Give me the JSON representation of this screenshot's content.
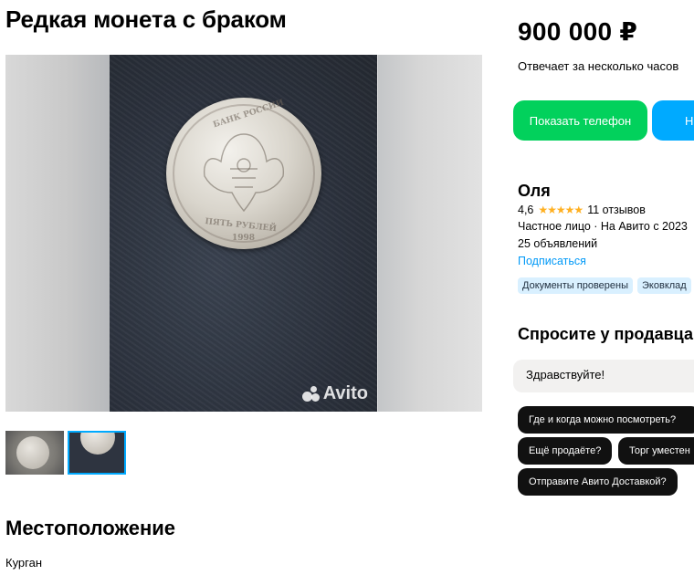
{
  "listing": {
    "title": "Редкая монета с браком",
    "location_heading": "Местоположение",
    "location_value": "Курган"
  },
  "gallery": {
    "watermark": "Avito",
    "thumbnails_count": 2,
    "selected_thumbnail": 2
  },
  "sidebar": {
    "price": "900 000 ₽",
    "reply_time": "Отвечает за несколько часов",
    "show_phone_label": "Показать телефон",
    "message_label": "Н",
    "seller": {
      "name": "Оля",
      "rating": "4,6",
      "stars": "★★★★★",
      "reviews": "11 отзывов",
      "type": "Частное лицо · На Авито с 2023",
      "ads_count": "25 объявлений",
      "subscribe": "Подписаться",
      "badges": [
        "Документы проверены",
        "Эковклад"
      ]
    },
    "ask": {
      "heading": "Спросите у продавца",
      "input_value": "Здравствуйте!",
      "chips": [
        "Где и когда можно посмотреть?",
        "Ещё продаёте?",
        "Торг уместен",
        "Отправите Авито Доставкой?"
      ]
    }
  },
  "colors": {
    "green_button": "#02d15c",
    "blue_button": "#00aaff",
    "link": "#0099f7",
    "badge_bg": "#d9f0ff",
    "stars": "#ffb021"
  }
}
